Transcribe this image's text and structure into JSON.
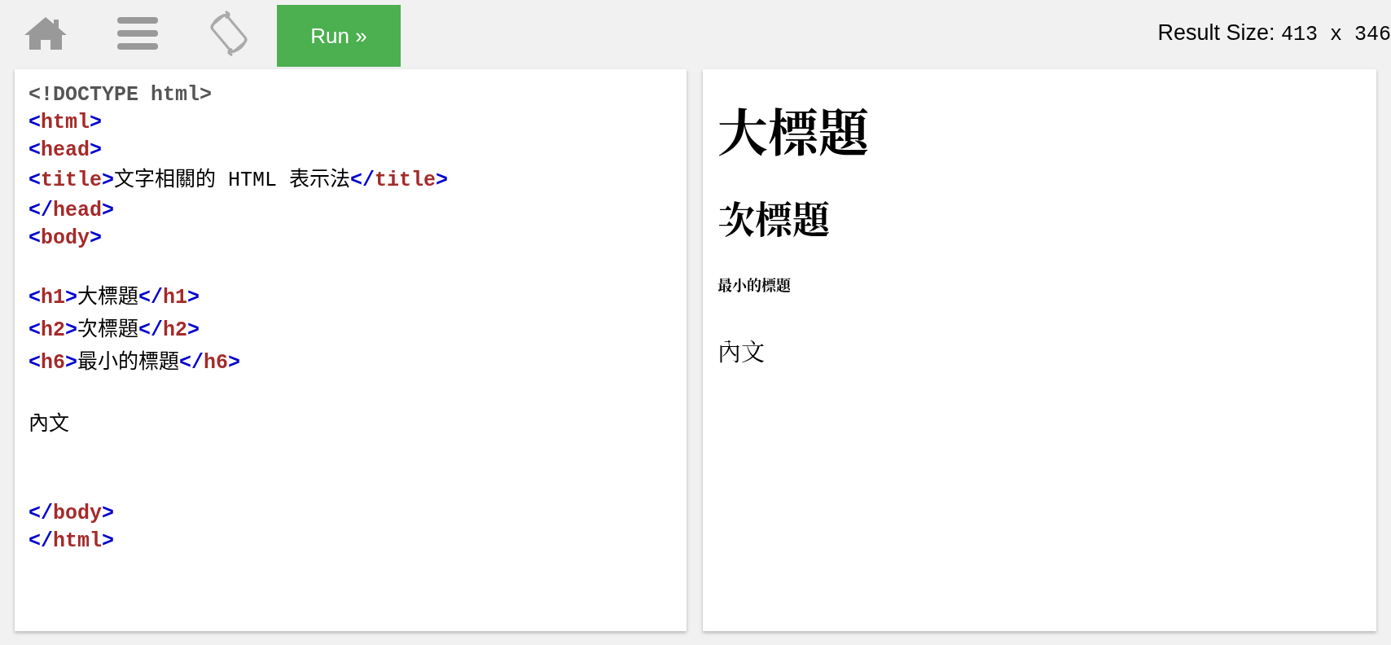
{
  "toolbar": {
    "run_button": "Run »",
    "result_size_label": "Result Size:",
    "result_size_value": "413 x 346"
  },
  "code_lines": [
    {
      "kind": "code",
      "tokens": [
        {
          "kind": "doctype",
          "text": "<!DOCTYPE html>"
        }
      ]
    },
    {
      "kind": "code",
      "tokens": [
        {
          "kind": "bracket",
          "text": "<"
        },
        {
          "kind": "tag",
          "text": "html"
        },
        {
          "kind": "bracket",
          "text": ">"
        }
      ]
    },
    {
      "kind": "code",
      "tokens": [
        {
          "kind": "bracket",
          "text": "<"
        },
        {
          "kind": "tag",
          "text": "head"
        },
        {
          "kind": "bracket",
          "text": ">"
        }
      ]
    },
    {
      "kind": "code",
      "tokens": [
        {
          "kind": "bracket",
          "text": "<"
        },
        {
          "kind": "tag",
          "text": "title"
        },
        {
          "kind": "bracket",
          "text": ">"
        },
        {
          "kind": "text",
          "text": "文字相關的 HTML 表示法"
        },
        {
          "kind": "bracket",
          "text": "</"
        },
        {
          "kind": "tag",
          "text": "title"
        },
        {
          "kind": "bracket",
          "text": ">"
        }
      ]
    },
    {
      "kind": "code",
      "tokens": [
        {
          "kind": "bracket",
          "text": "</"
        },
        {
          "kind": "tag",
          "text": "head"
        },
        {
          "kind": "bracket",
          "text": ">"
        }
      ]
    },
    {
      "kind": "code",
      "tokens": [
        {
          "kind": "bracket",
          "text": "<"
        },
        {
          "kind": "tag",
          "text": "body"
        },
        {
          "kind": "bracket",
          "text": ">"
        }
      ]
    },
    {
      "kind": "blank"
    },
    {
      "kind": "code",
      "tokens": [
        {
          "kind": "bracket",
          "text": "<"
        },
        {
          "kind": "tag",
          "text": "h1"
        },
        {
          "kind": "bracket",
          "text": ">"
        },
        {
          "kind": "text",
          "text": "大標題"
        },
        {
          "kind": "bracket",
          "text": "</"
        },
        {
          "kind": "tag",
          "text": "h1"
        },
        {
          "kind": "bracket",
          "text": ">"
        }
      ]
    },
    {
      "kind": "code",
      "tokens": [
        {
          "kind": "bracket",
          "text": "<"
        },
        {
          "kind": "tag",
          "text": "h2"
        },
        {
          "kind": "bracket",
          "text": ">"
        },
        {
          "kind": "text",
          "text": "次標題"
        },
        {
          "kind": "bracket",
          "text": "</"
        },
        {
          "kind": "tag",
          "text": "h2"
        },
        {
          "kind": "bracket",
          "text": ">"
        }
      ]
    },
    {
      "kind": "code",
      "tokens": [
        {
          "kind": "bracket",
          "text": "<"
        },
        {
          "kind": "tag",
          "text": "h6"
        },
        {
          "kind": "bracket",
          "text": ">"
        },
        {
          "kind": "text",
          "text": "最小的標題"
        },
        {
          "kind": "bracket",
          "text": "</"
        },
        {
          "kind": "tag",
          "text": "h6"
        },
        {
          "kind": "bracket",
          "text": ">"
        }
      ]
    },
    {
      "kind": "blank"
    },
    {
      "kind": "code",
      "tokens": [
        {
          "kind": "text",
          "text": "內文"
        }
      ]
    },
    {
      "kind": "blank"
    },
    {
      "kind": "blank"
    },
    {
      "kind": "code",
      "tokens": [
        {
          "kind": "bracket",
          "text": "</"
        },
        {
          "kind": "tag",
          "text": "body"
        },
        {
          "kind": "bracket",
          "text": ">"
        }
      ]
    },
    {
      "kind": "code",
      "tokens": [
        {
          "kind": "bracket",
          "text": "</"
        },
        {
          "kind": "tag",
          "text": "html"
        },
        {
          "kind": "bracket",
          "text": ">"
        }
      ]
    }
  ],
  "result": {
    "h1": "大標題",
    "h2": "次標題",
    "h6": "最小的標題",
    "paragraph": "內文"
  }
}
